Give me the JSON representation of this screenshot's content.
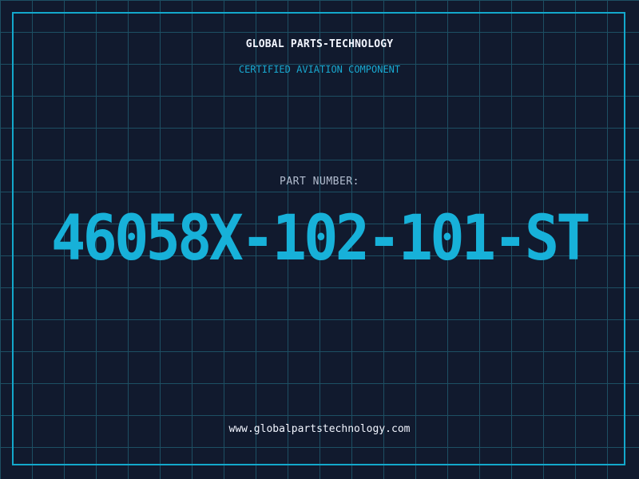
{
  "company": "GLOBAL PARTS-TECHNOLOGY",
  "subtitle": "CERTIFIED AVIATION COMPONENT",
  "part_label": "PART NUMBER:",
  "part_number": "46058X-102-101-ST",
  "website": "www.globalpartstechnology.com",
  "colors": {
    "background": "#111a2e",
    "grid": "#1d4f63",
    "accent": "#17b1d9",
    "text": "#f3f6ff",
    "label": "#b3bdcf"
  }
}
